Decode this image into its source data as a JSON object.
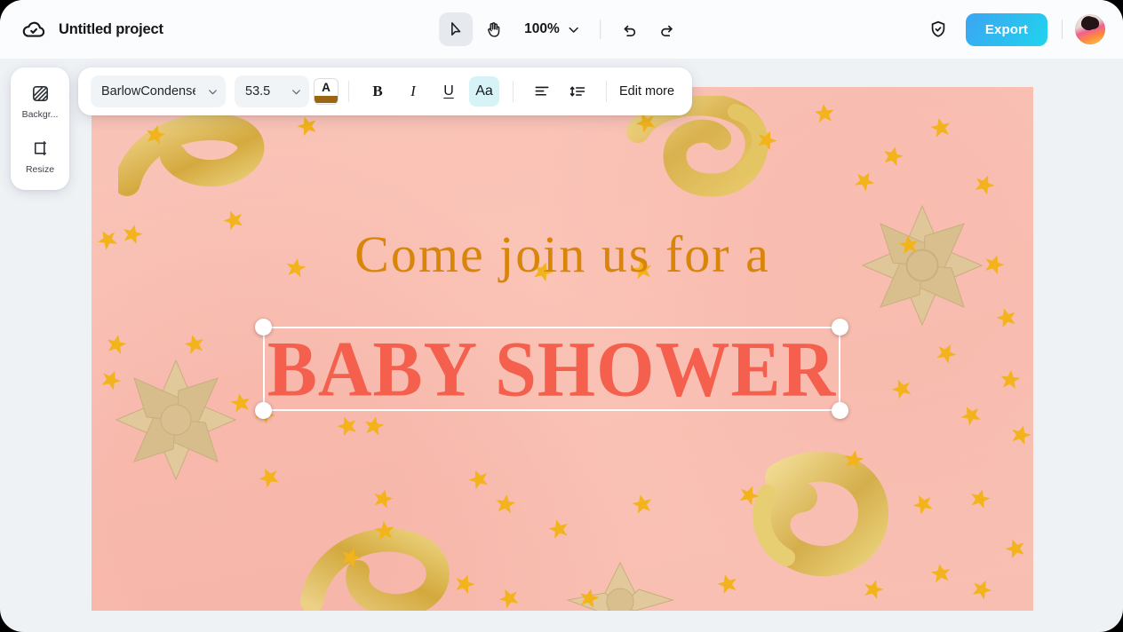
{
  "topbar": {
    "cloud_icon": "cloud-check-icon",
    "project_title": "Untitled project",
    "tools": [
      {
        "name": "select-tool",
        "icon": "cursor-arrow-icon",
        "active": true
      },
      {
        "name": "hand-tool",
        "icon": "hand-icon",
        "active": false
      }
    ],
    "zoom_level": "100%",
    "zoom_chevron": "chevron-down-icon",
    "undo_icon": "undo-arrow-icon",
    "redo_icon": "redo-arrow-icon",
    "shield_icon": "shield-check-icon",
    "export_label": "Export",
    "avatar": "user-avatar"
  },
  "sidebar": {
    "items": [
      {
        "label": "Backgr...",
        "icon": "background-hatch-icon",
        "name": "background"
      },
      {
        "label": "Resize",
        "icon": "resize-frame-icon",
        "name": "resize"
      }
    ]
  },
  "text_toolbar": {
    "font_family": "BarlowCondense",
    "font_size": "53.5",
    "text_color_letter": "A",
    "text_color_swatch": "#9C6512",
    "bold_label": "B",
    "italic_label": "I",
    "underline_label": "U",
    "case_label": "Aa",
    "case_active": true,
    "align_icon": "align-left-icon",
    "line_spacing_icon": "line-spacing-icon",
    "edit_more_label": "Edit more"
  },
  "canvas": {
    "background_color": "#F9C2B6",
    "heading_line1": "Come join us for a",
    "heading_line1_color": "#D98509",
    "heading_line2": "BABY SHOWER",
    "heading_line2_color": "#F4604D",
    "selection": {
      "handles": [
        "top-left",
        "top-right",
        "bottom-left",
        "bottom-right"
      ],
      "border_color": "#FFFFFF"
    }
  },
  "colors": {
    "page_background": "#EFF2F5",
    "topbar_background": "#FBFCFD",
    "export_gradient_start": "#3CA4F2",
    "export_gradient_end": "#1FD4EE",
    "highlight": "#D6F4F8",
    "active_tool_bg": "#E6EAEF"
  }
}
